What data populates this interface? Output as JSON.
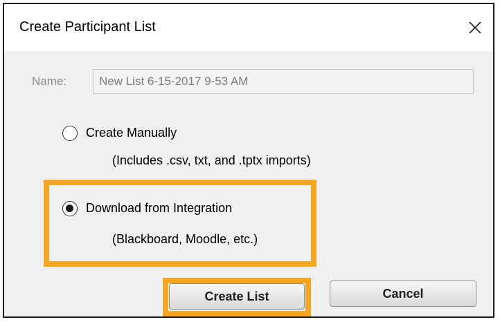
{
  "dialog": {
    "title": "Create Participant List",
    "close_icon": "close-icon"
  },
  "name_field": {
    "label": "Name:",
    "value": "New List 6-15-2017 9-53 AM"
  },
  "options": [
    {
      "label": "Create Manually",
      "description": "(Includes .csv, txt, and .tptx imports)",
      "selected": false
    },
    {
      "label": "Download from Integration",
      "description": "(Blackboard, Moodle, etc.)",
      "selected": true
    }
  ],
  "buttons": {
    "create_label": "Create List",
    "cancel_label": "Cancel"
  },
  "colors": {
    "highlight": "#f5a623",
    "dialog_bg": "#f0f0f0"
  }
}
